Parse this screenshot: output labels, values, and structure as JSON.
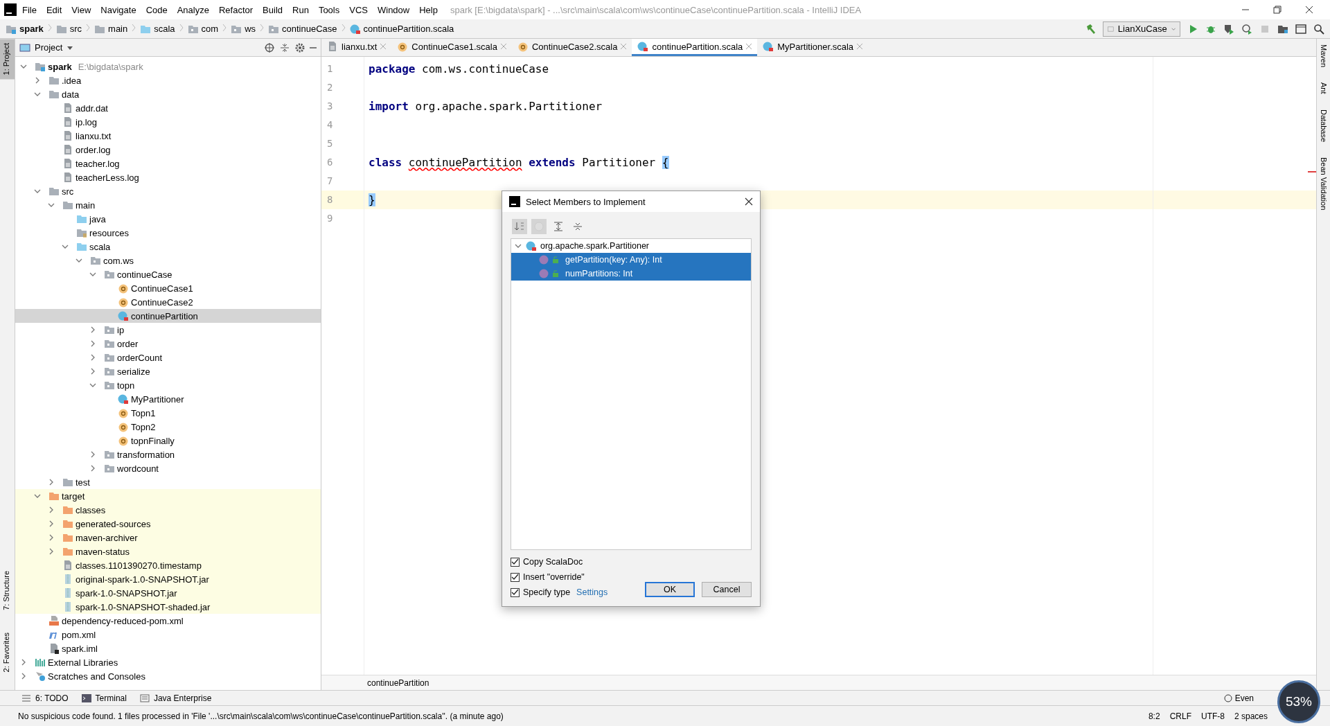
{
  "window": {
    "title": "spark [E:\\bigdata\\spark] - ...\\src\\main\\scala\\com\\ws\\continueCase\\continuePartition.scala - IntelliJ IDEA"
  },
  "menu": [
    "File",
    "Edit",
    "View",
    "Navigate",
    "Code",
    "Analyze",
    "Refactor",
    "Build",
    "Run",
    "Tools",
    "VCS",
    "Window",
    "Help"
  ],
  "breadcrumbs": [
    {
      "label": "spark",
      "kind": "project"
    },
    {
      "label": "src",
      "kind": "folder"
    },
    {
      "label": "main",
      "kind": "folder"
    },
    {
      "label": "scala",
      "kind": "source"
    },
    {
      "label": "com",
      "kind": "package"
    },
    {
      "label": "ws",
      "kind": "package"
    },
    {
      "label": "continueCase",
      "kind": "package"
    },
    {
      "label": "continuePartition.scala",
      "kind": "class"
    }
  ],
  "run_config": "LianXuCase",
  "left_strip": [
    {
      "label": "1: Project",
      "selected": true
    },
    {
      "label": "7: Structure",
      "selected": false
    },
    {
      "label": "2: Favorites",
      "selected": false
    }
  ],
  "right_strip": [
    "Maven",
    "Ant",
    "Database",
    "Bean Validation"
  ],
  "project": {
    "title": "Project",
    "tree": [
      {
        "label": "spark",
        "path": "E:\\bigdata\\spark",
        "kind": "project",
        "expanded": true,
        "selected": false,
        "children": [
          {
            "label": ".idea",
            "kind": "folder",
            "expanded": false,
            "selected": false
          },
          {
            "label": "data",
            "kind": "folder",
            "expanded": true,
            "selected": false,
            "children": [
              {
                "label": "addr.dat",
                "kind": "file",
                "selected": false
              },
              {
                "label": "ip.log",
                "kind": "file",
                "selected": false
              },
              {
                "label": "lianxu.txt",
                "kind": "file",
                "selected": false
              },
              {
                "label": "order.log",
                "kind": "file",
                "selected": false
              },
              {
                "label": "teacher.log",
                "kind": "file",
                "selected": false
              },
              {
                "label": "teacherLess.log",
                "kind": "file",
                "selected": false
              }
            ]
          },
          {
            "label": "src",
            "kind": "folder",
            "expanded": true,
            "selected": false,
            "children": [
              {
                "label": "main",
                "kind": "folder",
                "expanded": true,
                "selected": false,
                "children": [
                  {
                    "label": "java",
                    "kind": "source",
                    "selected": false
                  },
                  {
                    "label": "resources",
                    "kind": "resources",
                    "selected": false
                  },
                  {
                    "label": "scala",
                    "kind": "source",
                    "expanded": true,
                    "selected": false,
                    "children": [
                      {
                        "label": "com.ws",
                        "kind": "package",
                        "expanded": true,
                        "selected": false,
                        "children": [
                          {
                            "label": "continueCase",
                            "kind": "package",
                            "expanded": true,
                            "selected": false,
                            "children": [
                              {
                                "label": "ContinueCase1",
                                "kind": "object",
                                "selected": false
                              },
                              {
                                "label": "ContinueCase2",
                                "kind": "object",
                                "selected": false
                              },
                              {
                                "label": "continuePartition",
                                "kind": "class",
                                "selected": true
                              }
                            ]
                          },
                          {
                            "label": "ip",
                            "kind": "package",
                            "expanded": false,
                            "selected": false
                          },
                          {
                            "label": "order",
                            "kind": "package",
                            "expanded": false,
                            "selected": false
                          },
                          {
                            "label": "orderCount",
                            "kind": "package",
                            "expanded": false,
                            "selected": false
                          },
                          {
                            "label": "serialize",
                            "kind": "package",
                            "expanded": false,
                            "selected": false
                          },
                          {
                            "label": "topn",
                            "kind": "package",
                            "expanded": true,
                            "selected": false,
                            "children": [
                              {
                                "label": "MyPartitioner",
                                "kind": "class",
                                "selected": false
                              },
                              {
                                "label": "Topn1",
                                "kind": "object",
                                "selected": false
                              },
                              {
                                "label": "Topn2",
                                "kind": "object",
                                "selected": false
                              },
                              {
                                "label": "topnFinally",
                                "kind": "object",
                                "selected": false
                              }
                            ]
                          },
                          {
                            "label": "transformation",
                            "kind": "package",
                            "expanded": false,
                            "selected": false
                          },
                          {
                            "label": "wordcount",
                            "kind": "package",
                            "expanded": false,
                            "selected": false
                          }
                        ]
                      }
                    ]
                  }
                ]
              },
              {
                "label": "test",
                "kind": "folder",
                "expanded": false,
                "selected": false
              }
            ]
          },
          {
            "label": "target",
            "kind": "excluded",
            "expanded": true,
            "selected": false,
            "children": [
              {
                "label": "classes",
                "kind": "excluded",
                "expanded": false,
                "selected": false
              },
              {
                "label": "generated-sources",
                "kind": "excluded",
                "expanded": false,
                "selected": false
              },
              {
                "label": "maven-archiver",
                "kind": "excluded",
                "expanded": false,
                "selected": false
              },
              {
                "label": "maven-status",
                "kind": "excluded",
                "expanded": false,
                "selected": false
              },
              {
                "label": "classes.1101390270.timestamp",
                "kind": "file",
                "selected": false
              },
              {
                "label": "original-spark-1.0-SNAPSHOT.jar",
                "kind": "jar",
                "selected": false
              },
              {
                "label": "spark-1.0-SNAPSHOT.jar",
                "kind": "jar",
                "selected": false
              },
              {
                "label": "spark-1.0-SNAPSHOT-shaded.jar",
                "kind": "jar",
                "selected": false
              }
            ]
          },
          {
            "label": "dependency-reduced-pom.xml",
            "kind": "xml",
            "selected": false
          },
          {
            "label": "pom.xml",
            "kind": "maven",
            "selected": false
          },
          {
            "label": "spark.iml",
            "kind": "iml",
            "selected": false
          }
        ]
      },
      {
        "label": "External Libraries",
        "kind": "libraries",
        "expanded": false,
        "selected": false
      },
      {
        "label": "Scratches and Consoles",
        "kind": "scratches",
        "expanded": false,
        "selected": false
      }
    ]
  },
  "tabs": [
    {
      "label": "lianxu.txt",
      "kind": "file",
      "selected": false
    },
    {
      "label": "ContinueCase1.scala",
      "kind": "object",
      "selected": false
    },
    {
      "label": "ContinueCase2.scala",
      "kind": "object",
      "selected": false
    },
    {
      "label": "continuePartition.scala",
      "kind": "class",
      "selected": true
    },
    {
      "label": "MyPartitioner.scala",
      "kind": "class",
      "selected": false
    }
  ],
  "code": [
    {
      "number": "1",
      "current": false,
      "tokens": [
        {
          "text": "package",
          "kind": "keyword"
        },
        {
          "text": " com.ws.continueCase",
          "kind": "plain"
        }
      ]
    },
    {
      "number": "2",
      "current": false
    },
    {
      "number": "3",
      "current": false,
      "tokens": [
        {
          "text": "import",
          "kind": "keyword"
        },
        {
          "text": " org.apache.spark.Partitioner",
          "kind": "plain"
        }
      ]
    },
    {
      "number": "4",
      "current": false
    },
    {
      "number": "5",
      "current": false
    },
    {
      "number": "6",
      "current": false,
      "tokens": [
        {
          "text": "class ",
          "kind": "keyword"
        },
        {
          "text": "continuePartition",
          "kind": "error"
        },
        {
          "text": " extends",
          "kind": "keyword"
        },
        {
          "text": " Partitioner ",
          "kind": "plain"
        },
        {
          "text": "{",
          "kind": "brace"
        }
      ]
    },
    {
      "number": "7",
      "current": false
    },
    {
      "number": "8",
      "current": true,
      "tokens": [
        {
          "text": "}",
          "kind": "brace"
        }
      ]
    },
    {
      "number": "9",
      "current": false
    }
  ],
  "editor_breadcrumb": "continuePartition",
  "dialog": {
    "title": "Select Members to Implement",
    "root": {
      "label": "org.apache.spark.Partitioner",
      "expanded": true
    },
    "members": [
      {
        "label": "getPartition(key: Any): Int",
        "selected": true
      },
      {
        "label": "numPartitions: Int",
        "selected": true
      }
    ],
    "options": [
      {
        "label": "Copy ScalaDoc",
        "checked": true
      },
      {
        "label": "Insert \"override\"",
        "checked": true
      },
      {
        "label": "Specify type",
        "checked": true
      }
    ],
    "settings_link": "Settings",
    "buttons": [
      {
        "label": "OK",
        "default": true
      },
      {
        "label": "Cancel",
        "default": false
      }
    ]
  },
  "tool_tabs": [
    {
      "label": "6: TODO",
      "kind": "todo"
    },
    {
      "label": "Terminal",
      "kind": "terminal"
    },
    {
      "label": "Java Enterprise",
      "kind": "enterprise"
    }
  ],
  "event_log": "Even",
  "memory": "53%",
  "status": {
    "message": "No suspicious code found. 1 files processed in 'File '...\\src\\main\\scala\\com\\ws\\continueCase\\continuePartition.scala''. (a minute ago)",
    "items": [
      "8:2",
      "CRLF",
      "UTF-8",
      "2 spaces"
    ]
  }
}
